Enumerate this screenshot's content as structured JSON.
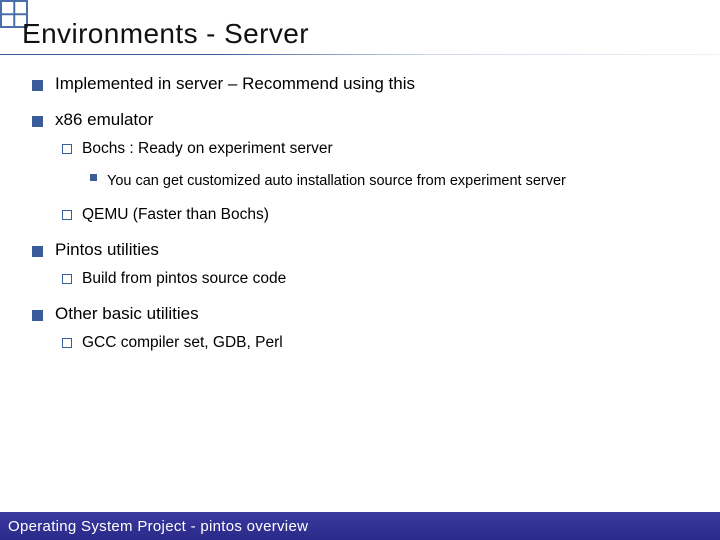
{
  "title": "Environments - Server",
  "bullets": [
    {
      "text": "Implemented in server – Recommend using this"
    },
    {
      "text": "x86 emulator",
      "children": [
        {
          "text": "Bochs : Ready on experiment server",
          "children": [
            {
              "text": "You can get customized auto installation source from experiment server"
            }
          ]
        },
        {
          "text": "QEMU (Faster than Bochs)"
        }
      ]
    },
    {
      "text": "Pintos utilities",
      "children": [
        {
          "text": "Build from pintos source code"
        }
      ]
    },
    {
      "text": "Other basic utilities",
      "children": [
        {
          "text": "GCC compiler set, GDB, Perl"
        }
      ]
    }
  ],
  "footer": "Operating System Project - pintos overview"
}
